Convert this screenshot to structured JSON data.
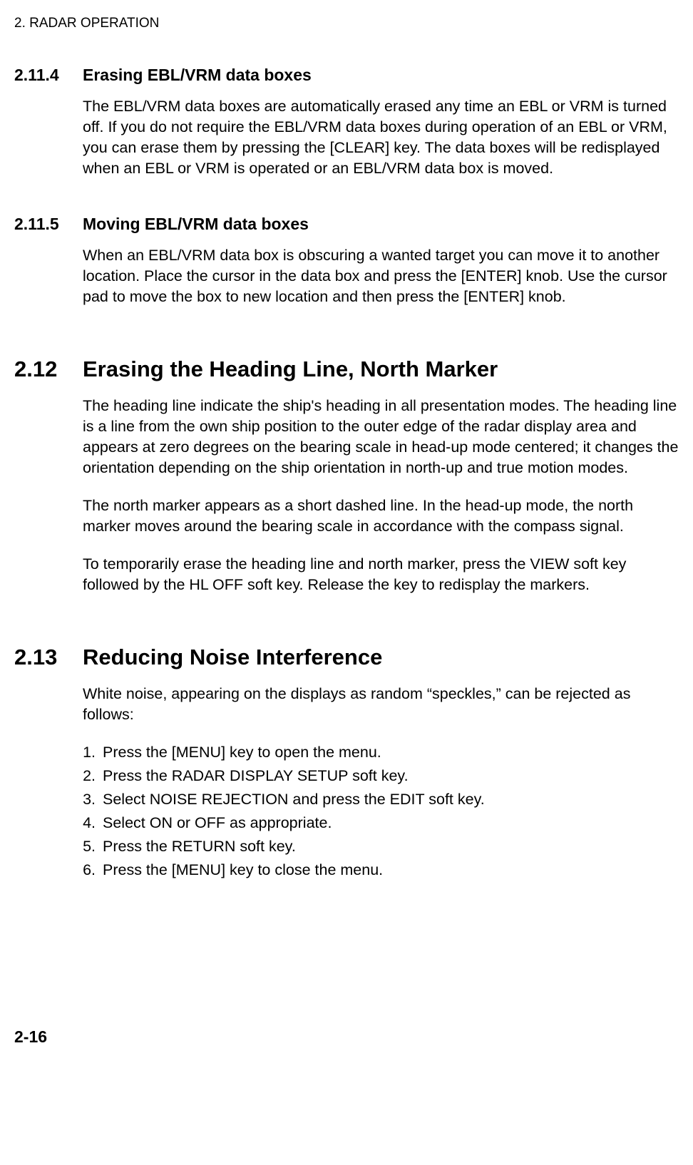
{
  "header": "2. RADAR OPERATION",
  "s2_11_4": {
    "num": "2.11.4",
    "title": "Erasing EBL/VRM data boxes",
    "p1": "The EBL/VRM data boxes are automatically erased any time an EBL or VRM is turned off. If you do not require the EBL/VRM data boxes during operation of an EBL or VRM, you can erase them by pressing the [CLEAR] key. The data boxes will be redisplayed when an EBL or VRM is operated or an EBL/VRM data box is moved."
  },
  "s2_11_5": {
    "num": "2.11.5",
    "title": "Moving EBL/VRM data boxes",
    "p1": "When an EBL/VRM data box is obscuring a wanted target you can move it to another location. Place the cursor in the data box and press the [ENTER] knob. Use the cursor pad to move the box to new location and then press the [ENTER] knob."
  },
  "s2_12": {
    "num": "2.12",
    "title": "Erasing the Heading Line, North Marker",
    "p1": "The heading line indicate the ship's heading in all presentation modes. The heading line is a line from the own ship position to the outer edge of the radar display area and appears at zero degrees on the bearing scale in head-up mode centered; it changes the orientation depending on the ship orientation in north-up and true motion modes.",
    "p2": "The north marker appears as a short dashed line. In the head-up mode, the north marker moves around the bearing scale in accordance with the compass signal.",
    "p3": "To temporarily erase the heading line and north marker, press the VIEW soft key followed by the HL OFF soft key. Release the key to redisplay the markers."
  },
  "s2_13": {
    "num": "2.13",
    "title": "Reducing Noise Interference",
    "p1": "White noise, appearing on the displays as random “speckles,” can be rejected as follows:",
    "steps": [
      "Press the [MENU] key to open the menu.",
      "Press the RADAR DISPLAY SETUP soft key.",
      "Select NOISE REJECTION and press the EDIT soft key.",
      "Select ON or OFF as appropriate.",
      "Press the RETURN soft key.",
      "Press the [MENU] key to close the menu."
    ]
  },
  "page_num": "2-16"
}
